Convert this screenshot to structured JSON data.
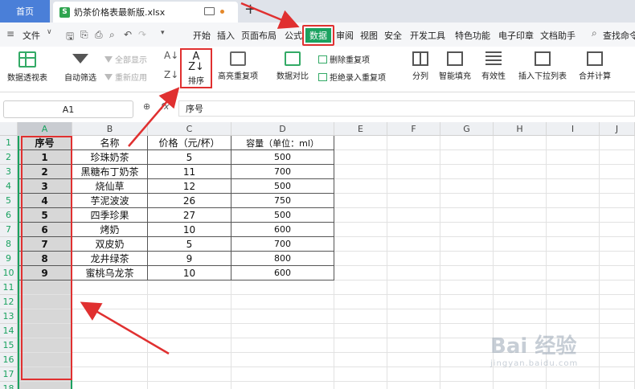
{
  "tabs": {
    "home": "首页",
    "file_icon_letter": "S",
    "file_name": "奶茶价格表最新版.xlsx",
    "new_tab": "+"
  },
  "menu": {
    "file": "文件",
    "items": [
      "开始",
      "插入",
      "页面布局",
      "公式"
    ],
    "active": "数据",
    "items_after": [
      "审阅",
      "视图",
      "安全",
      "开发工具",
      "特色功能",
      "电子印章",
      "文档助手"
    ],
    "search": "查找命令"
  },
  "ribbon": {
    "pivot": "数据透视表",
    "autofilter": "自动筛选",
    "show_all": "全部显示",
    "reapply": "重新应用",
    "sort": "排序",
    "highlight_dup": "高亮重复项",
    "compare": "数据对比",
    "delete_dup": "删除重复项",
    "reject_dup": "拒绝录入重复项",
    "split": "分列",
    "smart_fill": "智能填充",
    "validity": "有效性",
    "insert_dropdown": "插入下拉列表",
    "merge_calc": "合并计算"
  },
  "formula_bar": {
    "name_box": "A1",
    "fx": "fx",
    "content": "序号"
  },
  "grid": {
    "columns": [
      "A",
      "B",
      "C",
      "D",
      "E",
      "F",
      "G",
      "H",
      "I",
      "J"
    ],
    "rows": [
      "1",
      "2",
      "3",
      "4",
      "5",
      "6",
      "7",
      "8",
      "9",
      "10",
      "11",
      "12",
      "13",
      "14",
      "15",
      "16",
      "17",
      "18"
    ],
    "header_row": [
      "序号",
      "名称",
      "价格（元/杯）",
      "容量（单位：ml）"
    ],
    "data": [
      [
        "1",
        "珍珠奶茶",
        "5",
        "500"
      ],
      [
        "2",
        "黑糖布丁奶茶",
        "11",
        "700"
      ],
      [
        "3",
        "烧仙草",
        "12",
        "500"
      ],
      [
        "4",
        "芋泥波波",
        "26",
        "750"
      ],
      [
        "5",
        "四季珍果",
        "27",
        "500"
      ],
      [
        "6",
        "烤奶",
        "10",
        "600"
      ],
      [
        "7",
        "双皮奶",
        "5",
        "700"
      ],
      [
        "8",
        "龙井绿茶",
        "9",
        "800"
      ],
      [
        "9",
        "蜜桃乌龙茶",
        "10",
        "600"
      ]
    ]
  },
  "watermark": {
    "brand": "Bai 经验",
    "url": "jingyan.baidu.com"
  },
  "colors": {
    "accent_green": "#1aa260",
    "highlight_red": "#e03030",
    "tab_blue": "#4a7fd8"
  }
}
